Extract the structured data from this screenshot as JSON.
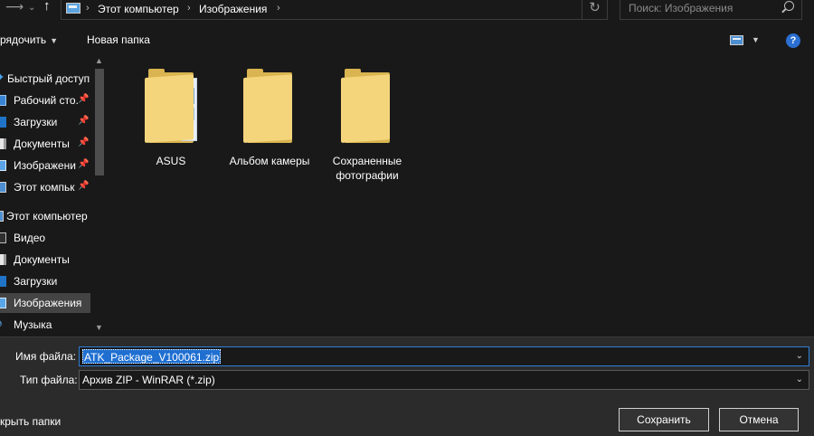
{
  "address_bar": {
    "back_icon": "arrow-right-icon",
    "forward_icon": "arrow-up-icon",
    "breadcrumbs": [
      "Этот компьютер",
      "Изображения"
    ],
    "refresh_icon": "refresh-icon"
  },
  "search": {
    "placeholder": "Поиск: Изображения",
    "value": ""
  },
  "toolbar": {
    "organize_label": "рядочить",
    "new_folder_label": "Новая папка",
    "view_icon": "view-options-icon",
    "help_icon": "help-icon",
    "help_glyph": "?"
  },
  "sidebar": {
    "items": [
      {
        "label": "Быстрый доступ",
        "icon": "star-icon",
        "pinned": false
      },
      {
        "label": "Рабочий сто.",
        "icon": "desktop-icon",
        "pinned": true
      },
      {
        "label": "Загрузки",
        "icon": "downloads-icon",
        "pinned": true
      },
      {
        "label": "Документы",
        "icon": "documents-icon",
        "pinned": true
      },
      {
        "label": "Изображени",
        "icon": "pictures-icon",
        "pinned": true
      },
      {
        "label": "Этот компьк",
        "icon": "pc-icon",
        "pinned": true
      },
      {
        "label": "Этот компьютер",
        "icon": "pc-icon",
        "pinned": false
      },
      {
        "label": "Видео",
        "icon": "video-icon",
        "pinned": false
      },
      {
        "label": "Документы",
        "icon": "documents-icon",
        "pinned": false
      },
      {
        "label": "Загрузки",
        "icon": "downloads-icon",
        "pinned": false
      },
      {
        "label": "Изображения",
        "icon": "pictures-icon",
        "pinned": false,
        "selected": true
      },
      {
        "label": "Музыка",
        "icon": "music-icon",
        "pinned": false
      }
    ]
  },
  "content": {
    "folders": [
      {
        "label": "ASUS",
        "has_contents": true
      },
      {
        "label": "Альбом камеры",
        "has_contents": false
      },
      {
        "label": "Сохраненные фотографии",
        "has_contents": false
      }
    ]
  },
  "save_panel": {
    "filename_label": "Имя файла:",
    "filename_value": "ATK_Package_V100061.zip",
    "filetype_label": "Тип файла:",
    "filetype_value": "Архив ZIP - WinRAR (*.zip)",
    "hide_folders_label": "крыть папки",
    "save_label": "Сохранить",
    "cancel_label": "Отмена"
  },
  "colors": {
    "background": "#191919",
    "panel": "#2b2b2b",
    "selection": "#1f6fd1",
    "folder": "#f4d57c"
  }
}
